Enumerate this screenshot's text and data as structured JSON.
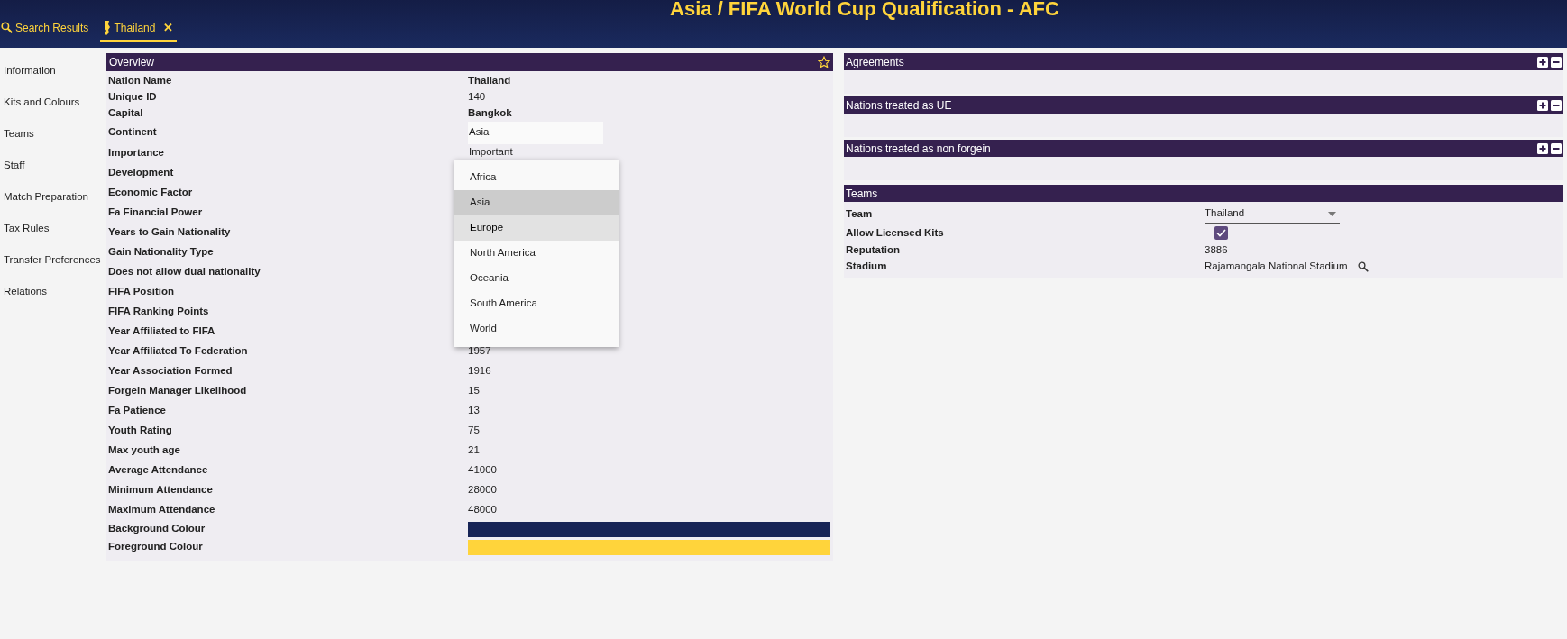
{
  "header": {
    "title": "Asia / FIFA World Cup Qualification - AFC"
  },
  "tabs": [
    {
      "label": "Search Results",
      "selected": false
    },
    {
      "label": "Thailand",
      "selected": true,
      "close": "✕"
    }
  ],
  "sidebar": {
    "items": [
      "Information",
      "Kits and Colours",
      "Teams",
      "Staff",
      "Match Preparation",
      "Tax Rules",
      "Transfer Preferences",
      "Relations"
    ]
  },
  "overview": {
    "title": "Overview",
    "favourite": false,
    "rows": [
      {
        "label": "Nation Name",
        "kind": "bold",
        "value": "Thailand"
      },
      {
        "label": "Unique ID",
        "kind": "text",
        "value": "140"
      },
      {
        "label": "Capital",
        "kind": "bold",
        "value": "Bangkok"
      },
      {
        "label": "Continent",
        "kind": "field",
        "value": "Asia"
      },
      {
        "label": "Importance",
        "kind": "dropdown",
        "value": "Important"
      },
      {
        "label": "Development",
        "kind": "hidden"
      },
      {
        "label": "Economic Factor",
        "kind": "hidden"
      },
      {
        "label": "Fa Financial Power",
        "kind": "hidden"
      },
      {
        "label": "Years to Gain Nationality",
        "kind": "hidden"
      },
      {
        "label": "Gain Nationality Type",
        "kind": "hidden"
      },
      {
        "label": "Does not allow dual nationality",
        "kind": "hidden"
      },
      {
        "label": "FIFA Position",
        "kind": "hidden"
      },
      {
        "label": "FIFA Ranking Points",
        "kind": "hidden"
      },
      {
        "label": "Year Affiliated to FIFA",
        "kind": "hidden"
      },
      {
        "label": "Year Affiliated To Federation",
        "kind": "text",
        "value": "1957"
      },
      {
        "label": "Year Association Formed",
        "kind": "text",
        "value": "1916"
      },
      {
        "label": "Forgein Manager Likelihood",
        "kind": "text",
        "value": "15"
      },
      {
        "label": "Fa Patience",
        "kind": "text",
        "value": "13"
      },
      {
        "label": "Youth Rating",
        "kind": "text",
        "value": "75"
      },
      {
        "label": "Max youth age",
        "kind": "text",
        "value": "21"
      },
      {
        "label": "Average Attendance",
        "kind": "text",
        "value": "41000"
      },
      {
        "label": "Minimum Attendance",
        "kind": "text",
        "value": "28000"
      },
      {
        "label": "Maximum Attendance",
        "kind": "text",
        "value": "48000"
      },
      {
        "label": "Background Colour",
        "kind": "color",
        "color": "#172456"
      },
      {
        "label": "Foreground Colour",
        "kind": "color",
        "color": "#ffd43b"
      }
    ]
  },
  "continent_dropdown": {
    "options": [
      {
        "label": "Africa",
        "selected": false,
        "hovered": false
      },
      {
        "label": "Asia",
        "selected": true,
        "hovered": false
      },
      {
        "label": "Europe",
        "selected": false,
        "hovered": true
      },
      {
        "label": "North America",
        "selected": false,
        "hovered": false
      },
      {
        "label": "Oceania",
        "selected": false,
        "hovered": false
      },
      {
        "label": "South America",
        "selected": false,
        "hovered": false
      },
      {
        "label": "World",
        "selected": false,
        "hovered": false
      }
    ]
  },
  "list_panels": [
    {
      "title": "Agreements"
    },
    {
      "title": "Nations treated as UE"
    },
    {
      "title": "Nations treated as non forgein"
    }
  ],
  "teams": {
    "title": "Teams",
    "rows": [
      {
        "label": "Team",
        "kind": "select",
        "value": "Thailand"
      },
      {
        "label": "Allow Licensed Kits",
        "kind": "checkbox",
        "checked": true
      },
      {
        "label": "Reputation",
        "kind": "text",
        "value": "3886"
      },
      {
        "label": "Stadium",
        "kind": "search",
        "value": "Rajamangala National Stadium"
      }
    ]
  }
}
